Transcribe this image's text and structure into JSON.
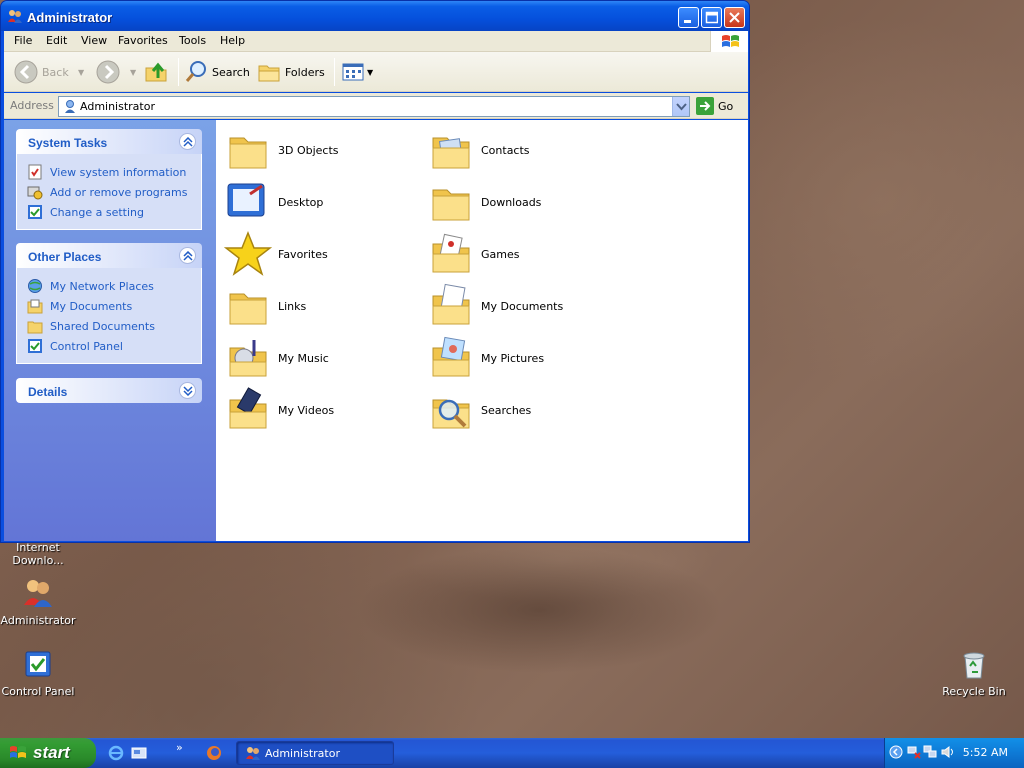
{
  "window": {
    "title": "Administrator",
    "menu": [
      "File",
      "Edit",
      "View",
      "Favorites",
      "Tools",
      "Help"
    ],
    "toolbar": {
      "back": "Back",
      "search": "Search",
      "folders": "Folders"
    },
    "address": {
      "label": "Address",
      "value": "Administrator",
      "go": "Go"
    }
  },
  "taskpane": {
    "system_tasks": {
      "title": "System Tasks",
      "links": [
        "View system information",
        "Add or remove programs",
        "Change a setting"
      ]
    },
    "other_places": {
      "title": "Other Places",
      "links": [
        "My Network Places",
        "My Documents",
        "Shared Documents",
        "Control Panel"
      ]
    },
    "details": {
      "title": "Details"
    }
  },
  "files": [
    "3D Objects",
    "Contacts",
    "Desktop",
    "Downloads",
    "Favorites",
    "Games",
    "Links",
    "My Documents",
    "My Music",
    "My Pictures",
    "My Videos",
    "Searches"
  ],
  "desktop": {
    "icons": {
      "idm_line1": "Internet",
      "idm_line2": "Downlo...",
      "administrator": "Administrator",
      "control_panel": "Control Panel",
      "recycle_bin": "Recycle Bin"
    }
  },
  "taskbar": {
    "start": "start",
    "quicklaunch_more": "»",
    "task_button": "Administrator",
    "clock": "5:52 AM"
  }
}
